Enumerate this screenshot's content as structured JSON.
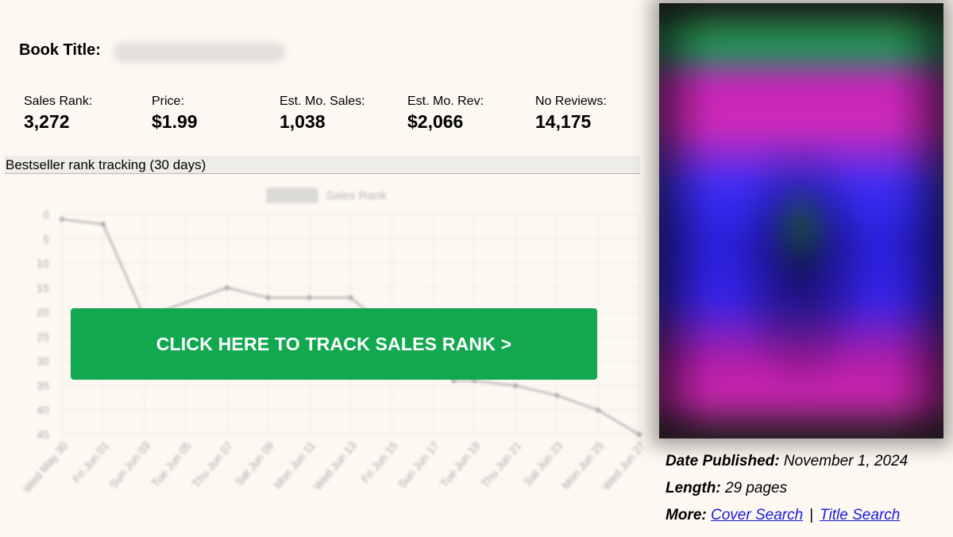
{
  "book": {
    "title_label": "Book Title:"
  },
  "stats": [
    {
      "label": "Sales Rank:",
      "value": "3,272"
    },
    {
      "label": "Price:",
      "value": "$1.99"
    },
    {
      "label": "Est. Mo. Sales:",
      "value": "1,038"
    },
    {
      "label": "Est. Mo. Rev:",
      "value": "$2,066"
    },
    {
      "label": "No Reviews:",
      "value": "14,175"
    }
  ],
  "rank_section": {
    "header": "Bestseller rank tracking (30 days)",
    "cta_label": "CLICK HERE TO TRACK SALES RANK >"
  },
  "chart_data": {
    "type": "line",
    "legend": [
      "Sales Rank"
    ],
    "legend_position": "top",
    "grid": true,
    "ylim": [
      0,
      45
    ],
    "y_inverted": true,
    "y_ticks": [
      0,
      5,
      10,
      15,
      20,
      25,
      30,
      35,
      40,
      45
    ],
    "categories": [
      "Wed May 30",
      "Fri Jun 01",
      "Sun Jun 03",
      "Tue Jun 05",
      "Thu Jun 07",
      "Sat Jun 09",
      "Mon Jun 11",
      "Wed Jun 13",
      "Fri Jun 15",
      "Sun Jun 17",
      "Tue Jun 19",
      "Thu Jun 21",
      "Sat Jun 23",
      "Mon Jun 25",
      "Wed Jun 27"
    ],
    "series": [
      {
        "name": "Sales Rank",
        "x": [
          0,
          1,
          2,
          4,
          5,
          6,
          7,
          9.5,
          10,
          11,
          12,
          13,
          14
        ],
        "values": [
          1,
          2,
          21,
          15,
          17,
          17,
          17,
          34,
          34,
          35,
          37,
          40,
          45
        ]
      }
    ],
    "color": "#999999"
  },
  "meta": {
    "date_label": "Date Published:",
    "date_value": "November 1, 2024",
    "length_label": "Length:",
    "length_value": "29 pages",
    "more_label": "More:",
    "cover_search": "Cover Search",
    "separator": "|",
    "title_search": "Title Search"
  }
}
